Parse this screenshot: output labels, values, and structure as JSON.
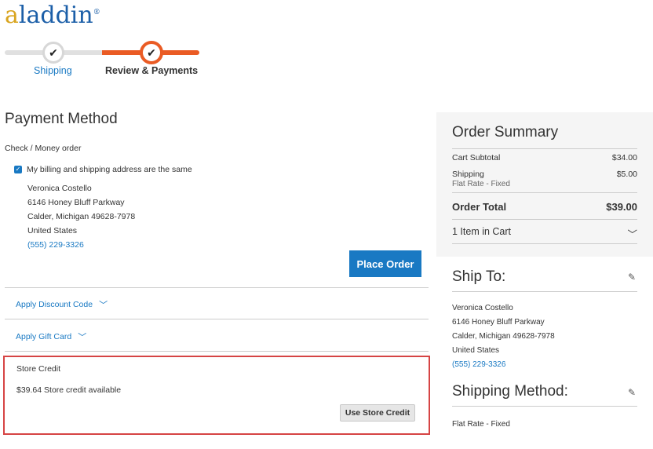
{
  "brand": {
    "name": "aladdin",
    "first_letter": "a",
    "rest": "laddin",
    "registered": "®"
  },
  "progress": {
    "steps": [
      {
        "label": "Shipping",
        "state": "complete"
      },
      {
        "label": "Review & Payments",
        "state": "active"
      }
    ],
    "check_glyph": "✔"
  },
  "payment": {
    "title": "Payment Method",
    "method": "Check / Money order",
    "same_address_label": "My billing and shipping address are the same",
    "address": {
      "name": "Veronica Costello",
      "street": "6146 Honey Bluff Parkway",
      "city_line": "Calder, Michigan 49628-7978",
      "country": "United States",
      "phone": "(555) 229-3326"
    },
    "place_order_label": "Place Order"
  },
  "discount": {
    "label": "Apply Discount Code"
  },
  "gift_card": {
    "label": "Apply Gift Card"
  },
  "store_credit": {
    "title": "Store Credit",
    "available": "$39.64 Store credit available",
    "button_label": "Use Store Credit"
  },
  "summary": {
    "title": "Order Summary",
    "cart_subtotal_label": "Cart Subtotal",
    "cart_subtotal_value": "$34.00",
    "shipping_label": "Shipping",
    "shipping_value": "$5.00",
    "shipping_method": "Flat Rate - Fixed",
    "order_total_label": "Order Total",
    "order_total_value": "$39.00",
    "items_in_cart": "1 Item in Cart"
  },
  "ship_to": {
    "title": "Ship To:",
    "address": {
      "name": "Veronica Costello",
      "street": "6146 Honey Bluff Parkway",
      "city_line": "Calder, Michigan 49628-7978",
      "country": "United States",
      "phone": "(555) 229-3326"
    }
  },
  "shipping_method": {
    "title": "Shipping Method:",
    "value": "Flat Rate - Fixed"
  },
  "colors": {
    "accent": "#1979c3",
    "progress": "#ea5b24",
    "highlight": "#d64444"
  }
}
